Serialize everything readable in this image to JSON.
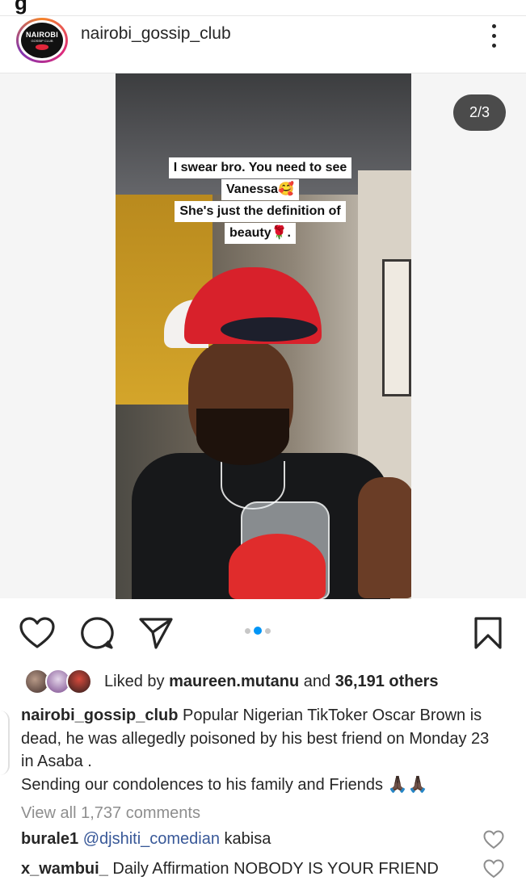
{
  "top": {
    "cut_title": "g"
  },
  "post": {
    "username": "nairobi_gossip_club",
    "avatar": {
      "brand": "NAIROBI",
      "sub": "GOSSIP CLUB"
    },
    "carousel_counter": "2/3",
    "video_caption": [
      "I swear bro. You need to see",
      "Vanessa🥰",
      "She's just the definition of",
      "beauty🌹."
    ],
    "carousel": {
      "total": 3,
      "active_index": 1
    }
  },
  "actions": {
    "icons": [
      "heart-icon",
      "comment-icon",
      "share-icon",
      "bookmark-icon"
    ]
  },
  "likes": {
    "prefix": "Liked by ",
    "user": "maureen.mutanu",
    "middle": " and ",
    "count": "36,191 others"
  },
  "caption": {
    "username": "nairobi_gossip_club",
    "text": " Popular Nigerian TikToker Oscar Brown is dead, he was allegedly poisoned by his best friend on Monday 23 in Asaba .",
    "line2": "Sending our condolences to his family and Friends 🙏🏿🙏🏿"
  },
  "view_all": "View all 1,737 comments",
  "comments": [
    {
      "username": "burale1",
      "mention": "@djshiti_comedian",
      "text": " kabisa"
    },
    {
      "username": "x_wambui_",
      "mention": "",
      "text": " Daily Affirmation NOBODY IS YOUR FRIEND"
    }
  ],
  "colors": {
    "accent": "#0095f6",
    "badge_bg": "#262626",
    "text": "#262626",
    "muted": "#8e8e8e"
  }
}
